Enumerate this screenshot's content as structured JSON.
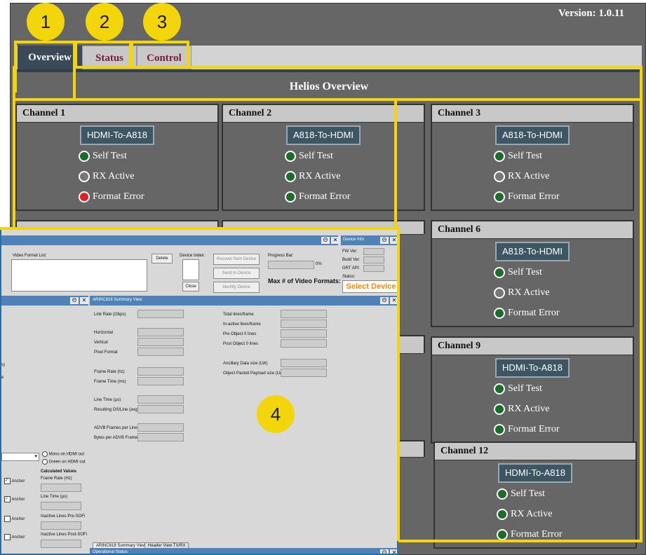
{
  "helios": {
    "version": "Version: 1.0.11",
    "tabs": [
      {
        "label": "Overview"
      },
      {
        "label": "Status"
      },
      {
        "label": "Control"
      }
    ],
    "page_title": "Helios Overview",
    "channels": [
      {
        "name": "Channel 1",
        "mode": "HDMI-To-A818",
        "indicators": [
          {
            "label": "Self Test",
            "state": "green"
          },
          {
            "label": "RX Active",
            "state": "off"
          },
          {
            "label": "Format Error",
            "state": "red"
          }
        ]
      },
      {
        "name": "Channel 2",
        "mode": "A818-To-HDMI",
        "indicators": [
          {
            "label": "Self Test",
            "state": "green"
          },
          {
            "label": "RX Active",
            "state": "green"
          },
          {
            "label": "Format Error",
            "state": "green"
          }
        ]
      },
      {
        "name": "Channel 3",
        "mode": "A818-To-HDMI",
        "indicators": [
          {
            "label": "Self Test",
            "state": "green"
          },
          {
            "label": "RX Active",
            "state": "off"
          },
          {
            "label": "Format Error",
            "state": "green"
          }
        ]
      },
      {
        "name": "Channel 6",
        "mode": "A818-To-HDMI",
        "indicators": [
          {
            "label": "Self Test",
            "state": "green"
          },
          {
            "label": "RX Active",
            "state": "off"
          },
          {
            "label": "Format Error",
            "state": "green"
          }
        ]
      },
      {
        "name": "Channel 9",
        "mode": "HDMI-To-A818",
        "indicators": [
          {
            "label": "Self Test",
            "state": "green"
          },
          {
            "label": "RX Active",
            "state": "green"
          },
          {
            "label": "Format Error",
            "state": "green"
          }
        ]
      },
      {
        "name": "Channel 12",
        "mode": "HDMI-To-A818",
        "indicators": [
          {
            "label": "Self Test",
            "state": "green"
          },
          {
            "label": "RX Active",
            "state": "green"
          },
          {
            "label": "Format Error",
            "state": "green"
          }
        ]
      }
    ]
  },
  "annotations": [
    "1",
    "2",
    "3",
    "4"
  ],
  "colors": {
    "highlight": "#f2d50a",
    "indicator_green": "#1c6c2a",
    "indicator_red": "#e02020",
    "tab_active": "#3a4a58",
    "tab_text": "#7a1a3a"
  },
  "arinc": {
    "video_format_list_label": "Video Format List:",
    "delete_label": "Delete",
    "device_index_label": "Device Index:",
    "close_label": "Close",
    "recover_label": "Recover from Device",
    "send_label": "Send to Device",
    "identify_label": "Identify Device",
    "progress_label": "Progress Bar:",
    "progress_value": "0%",
    "max_formats_label": "Max # of Video Formats:",
    "device_info": {
      "title": "Device Info",
      "fw_label": "FW Ver:",
      "build_label": "Build Ver:",
      "grt_label": "GRT API:",
      "status_label": "Status:",
      "status_value": "Select Device"
    },
    "summary_title": "ARINC818 Summary View",
    "summary_left": [
      "Link Rate (Gbps)",
      "Horizontal",
      "Vertical",
      "Pixel Format",
      "Frame Rate (hz)",
      "Frame Time (ms)",
      "Line Time (µs)",
      "Resulting OS/Line (avg.)",
      "ADVB Frames per Line",
      "Bytes per ADVB Frame"
    ],
    "summary_right": [
      "Total lines/frame",
      "In-active lines/frame",
      "Pre Object 0 lines",
      "Post Object 0 lines",
      "Ancillary  Data size (LW)",
      "Object Packet Payload size (LW)"
    ],
    "left_fragments": [
      "s)",
      "e"
    ],
    "radio_mono": "Mono on HDMI out",
    "radio_green": "Green on HDMI out",
    "calculated_title": "Calculated Values",
    "calc_fields": [
      "Frame Rate (Hz)",
      "Line Time (µs)",
      "Inactive Lines Pre-SOFi",
      "Inactive Lines Post-SOFi"
    ],
    "anchor_label": "Anchor",
    "bottom_tabs": [
      "ARINC818 Summary View",
      "Header View TX/RX"
    ],
    "operational_status": "Operational Status",
    "win_buttons": {
      "restore": "Θ",
      "close": "✕"
    }
  }
}
